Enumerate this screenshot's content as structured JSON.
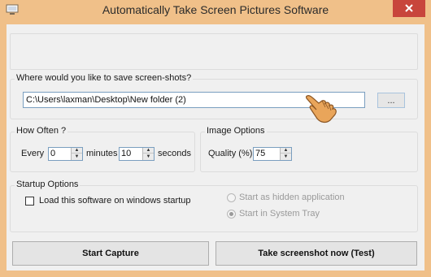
{
  "window": {
    "title": "Automatically Take Screen Pictures Software",
    "frame_color": "#f0c089",
    "close_color": "#c8453c"
  },
  "save": {
    "group_label": "Where would you like to save screen-shots?",
    "path": "C:\\Users\\laxman\\Desktop\\New folder (2)",
    "browse_label": "..."
  },
  "how_often": {
    "group_label": "How Often ?",
    "every_label": "Every",
    "minutes_value": "0",
    "minutes_label": "minutes",
    "seconds_value": "10",
    "seconds_label": "seconds"
  },
  "image_options": {
    "group_label": "Image Options",
    "quality_label": "Quality (%):",
    "quality_value": "75"
  },
  "startup": {
    "group_label": "Startup Options",
    "load_label": "Load this software on windows startup",
    "load_checked": false,
    "hidden_label": "Start as hidden application",
    "tray_label": "Start in System Tray",
    "selected": "tray"
  },
  "buttons": {
    "start_capture": "Start Capture",
    "test": "Take screenshot now (Test)"
  }
}
